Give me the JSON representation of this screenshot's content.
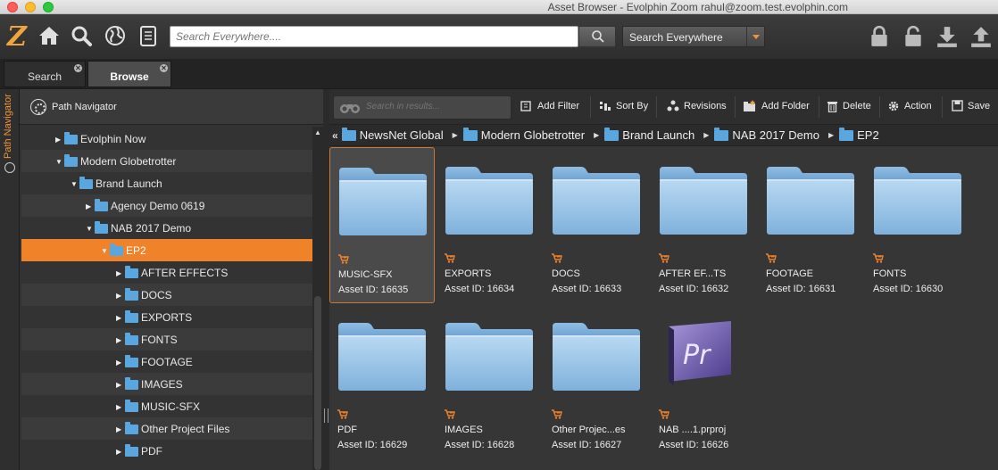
{
  "window": {
    "title": "Asset Browser - Evolphin Zoom rahul@zoom.test.evolphin.com"
  },
  "toolbar": {
    "logo": "Z",
    "search_placeholder": "Search Everywhere....",
    "scope_value": "Search Everywhere"
  },
  "tabs": [
    {
      "label": "Search"
    },
    {
      "label": "Browse"
    }
  ],
  "sidebar": {
    "vertical_label": "Path Navigator"
  },
  "left_panel": {
    "title": "Path Navigator",
    "tree": [
      {
        "label": "Evolphin Now",
        "depth": 0,
        "expanded": false
      },
      {
        "label": "Modern Globetrotter",
        "depth": 0,
        "expanded": true
      },
      {
        "label": "Brand Launch",
        "depth": 1,
        "expanded": true
      },
      {
        "label": "Agency Demo 0619",
        "depth": 2,
        "expanded": false
      },
      {
        "label": "NAB 2017 Demo",
        "depth": 2,
        "expanded": true
      },
      {
        "label": "EP2",
        "depth": 3,
        "expanded": true,
        "selected": true
      },
      {
        "label": "AFTER EFFECTS",
        "depth": 4,
        "expanded": false
      },
      {
        "label": "DOCS",
        "depth": 4,
        "expanded": false
      },
      {
        "label": "EXPORTS",
        "depth": 4,
        "expanded": false
      },
      {
        "label": "FONTS",
        "depth": 4,
        "expanded": false
      },
      {
        "label": "FOOTAGE",
        "depth": 4,
        "expanded": false
      },
      {
        "label": "IMAGES",
        "depth": 4,
        "expanded": false
      },
      {
        "label": "MUSIC-SFX",
        "depth": 4,
        "expanded": false
      },
      {
        "label": "Other Project Files",
        "depth": 4,
        "expanded": false
      },
      {
        "label": "PDF",
        "depth": 4,
        "expanded": false
      }
    ]
  },
  "right_panel": {
    "search_placeholder": "Search in results...",
    "buttons": {
      "add_filter": "Add Filter",
      "sort_by": "Sort By",
      "revisions": "Revisions",
      "add_folder": "Add Folder",
      "delete": "Delete",
      "action": "Action",
      "save": "Save"
    },
    "breadcrumb": [
      "NewsNet Global",
      "Modern Globetrotter",
      "Brand Launch",
      "NAB 2017 Demo",
      "EP2"
    ],
    "assets": [
      {
        "name": "MUSIC-SFX",
        "asset_id": "Asset ID: 16635",
        "kind": "folder",
        "selected": true
      },
      {
        "name": "EXPORTS",
        "asset_id": "Asset ID: 16634",
        "kind": "folder"
      },
      {
        "name": "DOCS",
        "asset_id": "Asset ID: 16633",
        "kind": "folder"
      },
      {
        "name": "AFTER EF...TS",
        "asset_id": "Asset ID: 16632",
        "kind": "folder"
      },
      {
        "name": "FOOTAGE",
        "asset_id": "Asset ID: 16631",
        "kind": "folder"
      },
      {
        "name": "FONTS",
        "asset_id": "Asset ID: 16630",
        "kind": "folder"
      },
      {
        "name": "PDF",
        "asset_id": "Asset ID: 16629",
        "kind": "folder"
      },
      {
        "name": "IMAGES",
        "asset_id": "Asset ID: 16628",
        "kind": "folder"
      },
      {
        "name": "Other Projec...es",
        "asset_id": "Asset ID: 16627",
        "kind": "folder"
      },
      {
        "name": "NAB ....1.prproj",
        "asset_id": "Asset ID: 16626",
        "kind": "premiere",
        "glyph": "Pr"
      }
    ]
  },
  "colors": {
    "accent": "#f0822a",
    "folder_blue": "#5aa7e0",
    "background": "#363636"
  }
}
